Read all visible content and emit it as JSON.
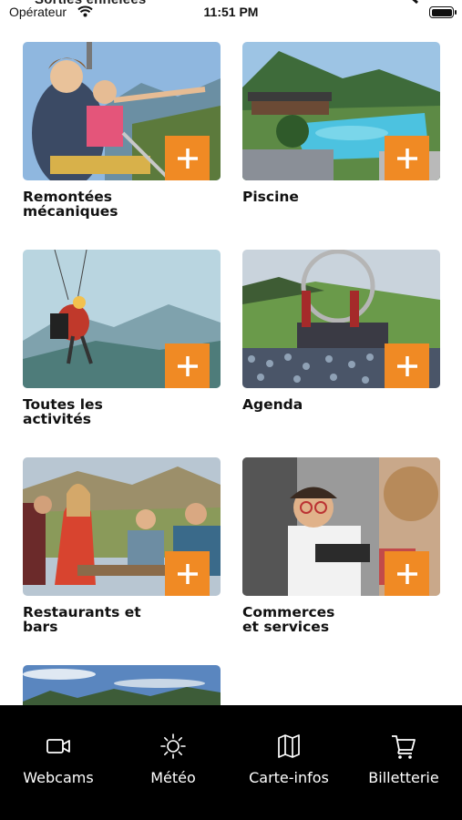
{
  "status_bar": {
    "partial_title": "Sorties enneiées",
    "carrier": "Opérateur",
    "time": "11:51 PM"
  },
  "tiles": [
    {
      "label": "Remontées\nmécaniques",
      "plus": "+"
    },
    {
      "label": "Piscine",
      "plus": "+"
    },
    {
      "label": "Toutes les\nactivités",
      "plus": "+"
    },
    {
      "label": "Agenda",
      "plus": "+"
    },
    {
      "label": "Restaurants et\nbars",
      "plus": "+"
    },
    {
      "label": "Commerces\net services",
      "plus": "+"
    },
    {
      "label": "",
      "plus": "+"
    }
  ],
  "tabbar": {
    "items": [
      {
        "label": "Webcams",
        "icon": "video-camera-icon"
      },
      {
        "label": "Météo",
        "icon": "sun-icon"
      },
      {
        "label": "Carte-infos",
        "icon": "map-icon"
      },
      {
        "label": "Billetterie",
        "icon": "cart-icon"
      }
    ]
  },
  "colors": {
    "accent": "#f08a24",
    "tabbar_bg": "#000000",
    "tab_text": "#ffffff"
  }
}
